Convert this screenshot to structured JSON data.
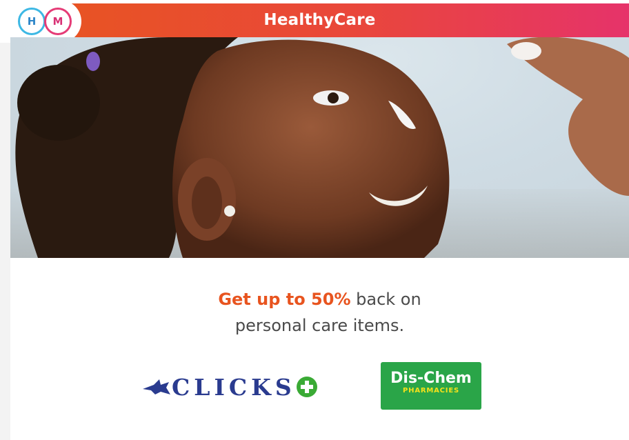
{
  "header": {
    "title": "HealthyCare",
    "logo_h": "H",
    "logo_m": "M"
  },
  "promo": {
    "highlight": "Get up to 50%",
    "line1_rest": " back on",
    "line2": "personal care items."
  },
  "partners": {
    "clicks_label": "CLICKS",
    "dischem_name": "Dis-Chem",
    "dischem_sub": "PHARMACIES"
  },
  "colors": {
    "accent_orange": "#e8541f",
    "accent_pink": "#e6336a",
    "clicks_blue": "#2a3b8f",
    "clicks_green": "#3aaa35",
    "dischem_green": "#2aa548",
    "dischem_yellow": "#f7e21a"
  }
}
